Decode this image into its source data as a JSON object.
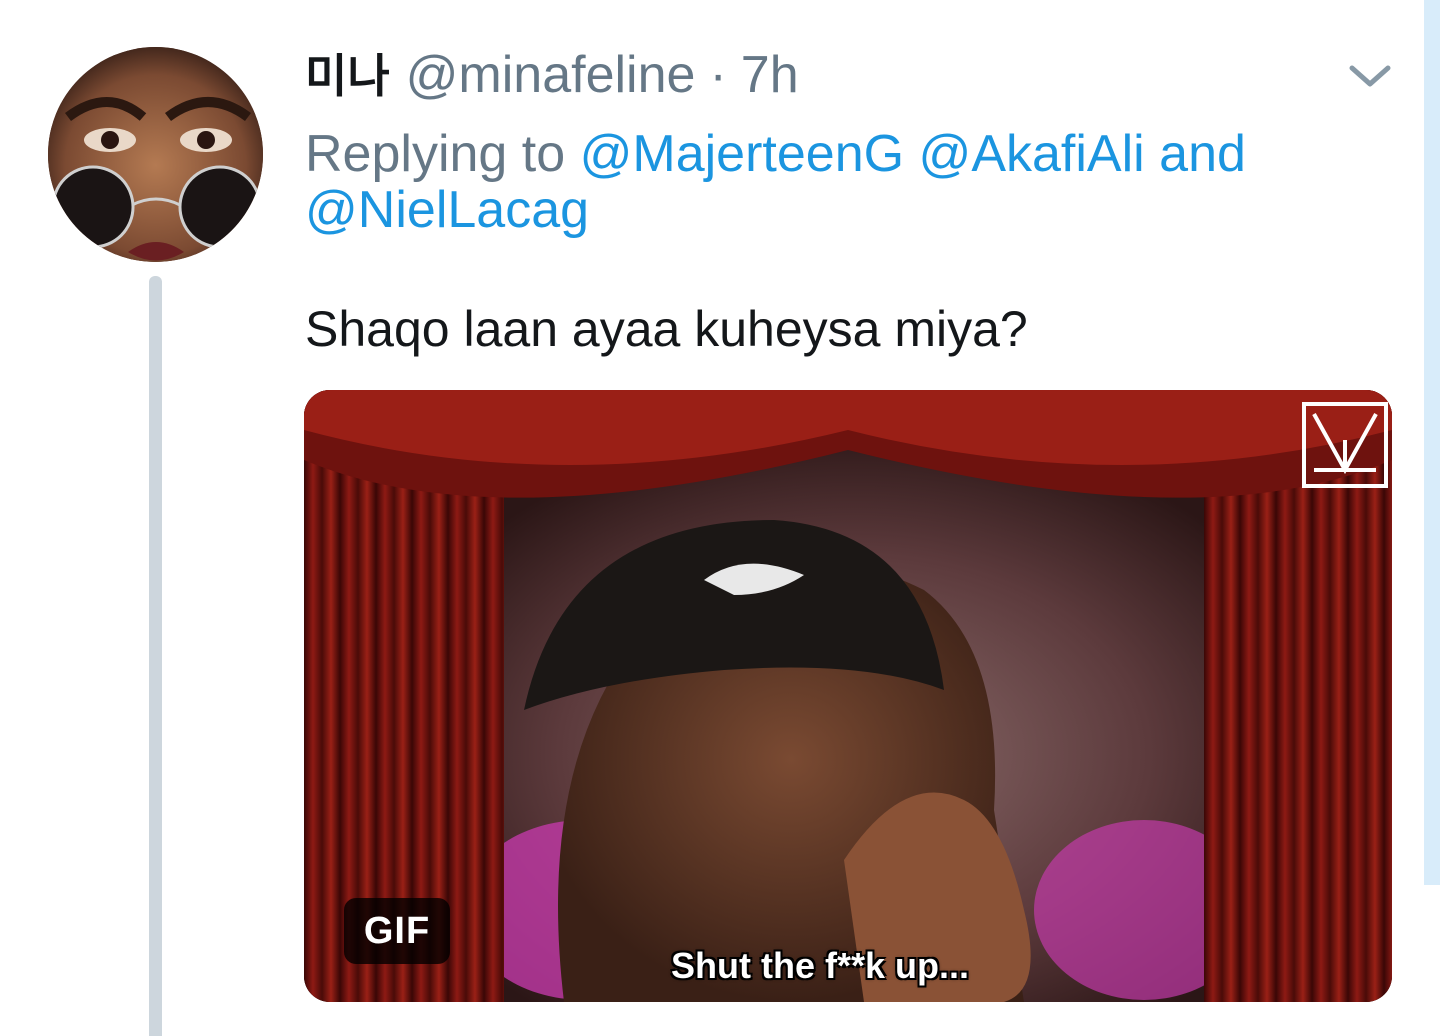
{
  "tweet": {
    "display_name": "미나",
    "handle": "@minafeline",
    "separator": "·",
    "time": "7h",
    "replying_prefix": "Replying to",
    "mentions": [
      "@MajerteenG",
      "@AkafiAli",
      "@NielLacag"
    ],
    "replying_joiner": "and",
    "text": "Shaqo laan ayaa kuheysa miya?"
  },
  "media": {
    "type_badge": "GIF",
    "caption": "Shut the f**k up..."
  },
  "icons": {
    "menu": "chevron-down-icon",
    "watermark": "leaf-logo-icon"
  },
  "colors": {
    "secondary_text": "#657786",
    "link": "#1b95e0",
    "thread_line": "#cdd6dd",
    "primary_text": "#14171a"
  }
}
